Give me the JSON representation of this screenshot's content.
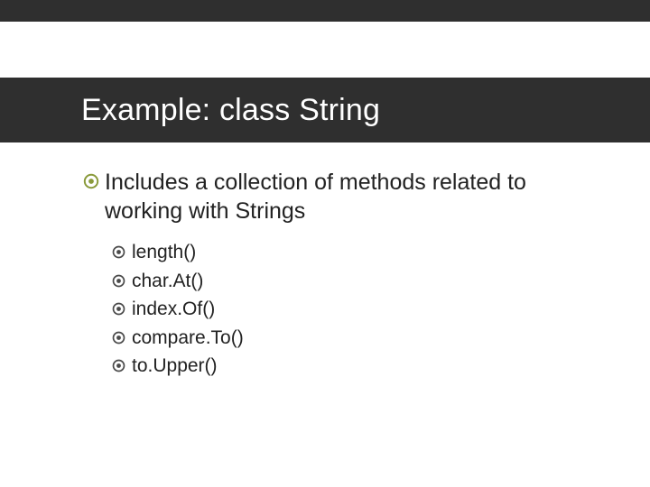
{
  "colors": {
    "bullet_olive": "#8a9a3b",
    "band": "#2f2f2f"
  },
  "title": "Example: class String",
  "bullets": {
    "main": {
      "text": "Includes a collection of methods related to working with Strings"
    },
    "sub": [
      {
        "text": "length()"
      },
      {
        "text": "char.At()"
      },
      {
        "text": "index.Of()"
      },
      {
        "text": "compare.To()"
      },
      {
        "text": "to.Upper()"
      }
    ]
  }
}
